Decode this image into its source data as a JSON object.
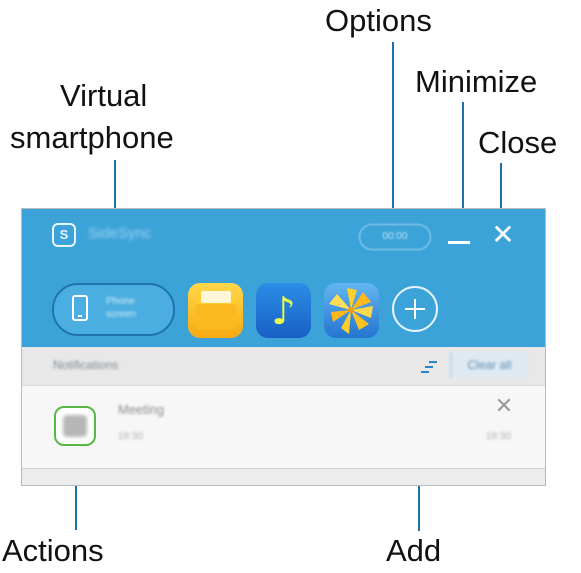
{
  "callouts": {
    "options": "Options",
    "minimize": "Minimize",
    "close": "Close",
    "virtual_smartphone_line1": "Virtual",
    "virtual_smartphone_line2": "smartphone",
    "actions": "Actions",
    "add": "Add"
  },
  "window": {
    "app_icon": "sidesync-icon",
    "app_title": "SideSync",
    "options_label": "00:00",
    "minimize_symbol": "—",
    "close_symbol": "✕",
    "phone_button": {
      "icon": "smartphone-icon",
      "label": "Phone screen"
    },
    "app_tiles": [
      {
        "name": "files-app-icon"
      },
      {
        "name": "music-app-icon",
        "glyph": "♪"
      },
      {
        "name": "gallery-app-icon"
      }
    ],
    "add_button_icon": "plus-icon"
  },
  "notifications": {
    "header_title": "Notifications",
    "sort_icon": "sort-icon",
    "clear_all_label": "Clear all",
    "items": [
      {
        "icon": "app-notification-icon",
        "title": "Meeting",
        "time_left": "18:30",
        "time_right": "18:30",
        "dismiss_symbol": "✕"
      }
    ]
  },
  "colors": {
    "titlebar": "#3ca3d9",
    "leader": "#1e6fa8",
    "action_outline": "#58b847"
  }
}
